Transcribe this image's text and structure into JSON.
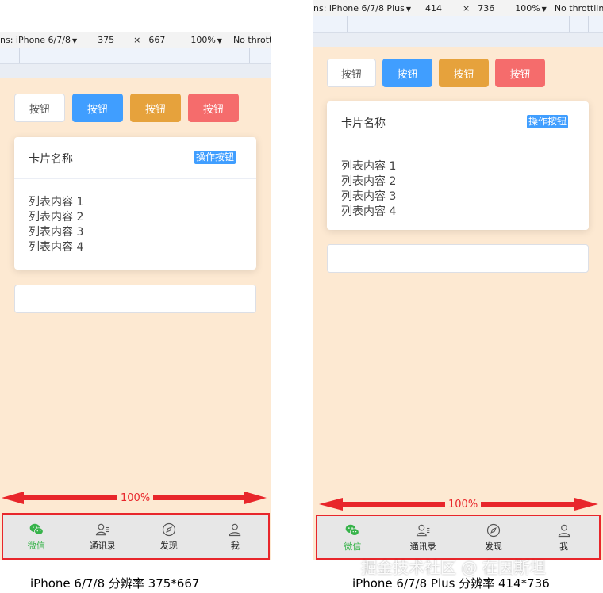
{
  "phones": [
    {
      "devbar": {
        "device": "ns: iPhone 6/7/8",
        "width": "375",
        "times": "×",
        "height": "667",
        "zoom": "100%",
        "throttle": "No throttl"
      },
      "buttons": [
        "按钮",
        "按钮",
        "按钮",
        "按钮"
      ],
      "card": {
        "title": "卡片名称",
        "action": "操作按钮",
        "items": [
          "列表内容 1",
          "列表内容 2",
          "列表内容 3",
          "列表内容 4"
        ]
      },
      "width_label": "100%",
      "tabs": [
        {
          "label": "微信",
          "icon": "wechat-icon",
          "active": true
        },
        {
          "label": "通讯录",
          "icon": "contacts-icon",
          "active": false
        },
        {
          "label": "发现",
          "icon": "compass-icon",
          "active": false
        },
        {
          "label": "我",
          "icon": "person-icon",
          "active": false
        }
      ],
      "caption": "iPhone 6/7/8  分辨率 375*667"
    },
    {
      "devbar": {
        "device": "ns: iPhone 6/7/8 Plus",
        "width": "414",
        "times": "×",
        "height": "736",
        "zoom": "100%",
        "throttle": "No throttling"
      },
      "buttons": [
        "按钮",
        "按钮",
        "按钮",
        "按钮"
      ],
      "card": {
        "title": "卡片名称",
        "action": "操作按钮",
        "items": [
          "列表内容 1",
          "列表内容 2",
          "列表内容 3",
          "列表内容 4"
        ]
      },
      "width_label": "100%",
      "tabs": [
        {
          "label": "微信",
          "icon": "wechat-icon",
          "active": true
        },
        {
          "label": "通讯录",
          "icon": "contacts-icon",
          "active": false
        },
        {
          "label": "发现",
          "icon": "compass-icon",
          "active": false
        },
        {
          "label": "我",
          "icon": "person-icon",
          "active": false
        }
      ],
      "caption": "iPhone 6/7/8 Plus  分辨率 414*736"
    }
  ],
  "watermark": "掘金技术社区 @ 在因斯坦",
  "colors": {
    "page_bg": "#fde9d2",
    "primary": "#409eff",
    "warning": "#e6a23c",
    "danger": "#f56c6c",
    "highlight": "#e8262b",
    "active_tab": "#37b34a"
  }
}
